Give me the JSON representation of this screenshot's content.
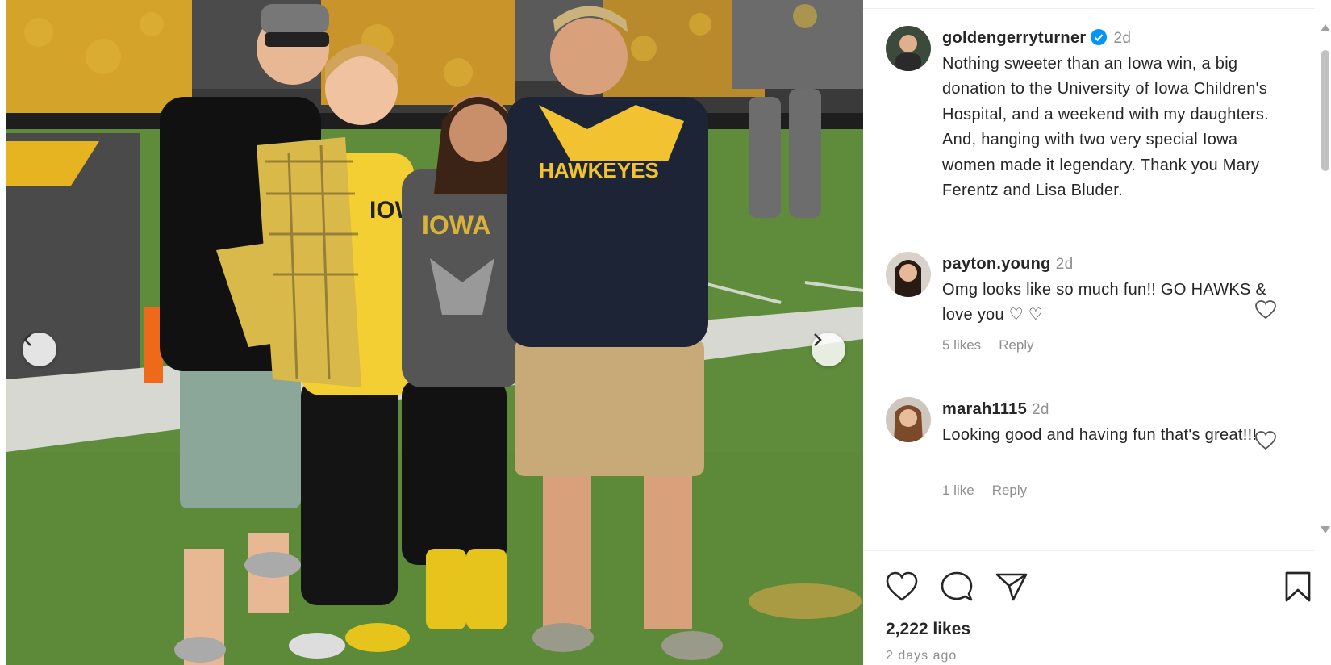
{
  "post": {
    "author": {
      "username": "goldengerryturner",
      "verified": true,
      "time": "2d"
    },
    "caption": "Nothing sweeter than an Iowa win, a big donation to the University of Iowa Children's Hospital, and a weekend with my daughters. And, hanging with two very special Iowa women made it legendary. Thank you Mary Ferentz and Lisa Bluder.",
    "photo": {
      "shirt_text": "HAWKEYES",
      "tee_text": "IOWA HAWKS",
      "gray_shirt_text": "IOWA"
    },
    "likes": "2,222 likes",
    "date": "2 days ago"
  },
  "comments": [
    {
      "username": "payton.young",
      "time": "2d",
      "text": "Omg looks like so much fun!! GO HAWKS & love you ♡ ♡",
      "likes": "5 likes",
      "reply": "Reply"
    },
    {
      "username": "marah1115",
      "time": "2d",
      "text": "Looking good and having fun that's great!!!",
      "likes": "1 like",
      "reply": "Reply"
    }
  ],
  "icons": {
    "prev": "chevron-left-icon",
    "next": "chevron-right-icon",
    "like": "heart-icon",
    "comment": "comment-bubble-icon",
    "share": "paper-plane-icon",
    "save": "bookmark-icon",
    "verified": "verified-badge-icon"
  },
  "colors": {
    "verified_blue": "#0095f6",
    "hawkeye_gold": "#f2c230",
    "text_primary": "#262626",
    "text_secondary": "#8e8e8e"
  }
}
